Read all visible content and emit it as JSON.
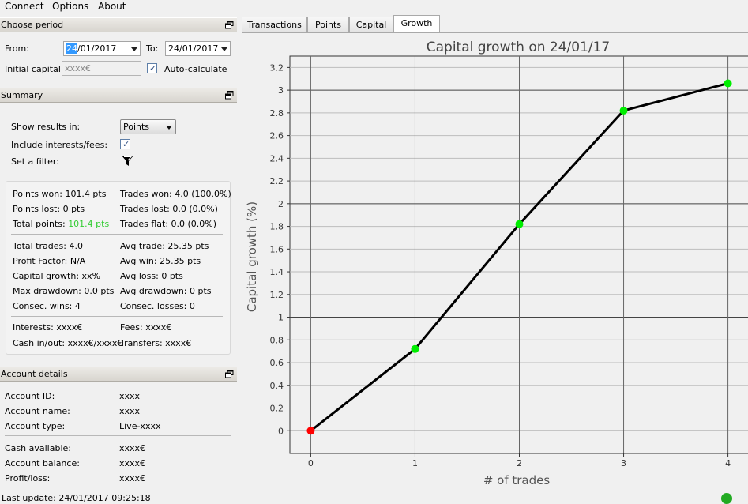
{
  "menu": {
    "items": [
      "Connect",
      "Options",
      "About"
    ]
  },
  "choose_period": {
    "title": "Choose period",
    "from_label": "From:",
    "from_value_selected": "24",
    "from_value_rest": "/01/2017",
    "to_label": "To:",
    "to_value": "24/01/2017",
    "initial_capital_label": "Initial capital:",
    "initial_capital_placeholder": "xxxx€",
    "auto_calc_label": "Auto-calculate",
    "auto_calc_checked": true
  },
  "summary": {
    "title": "Summary",
    "show_results_label": "Show results in:",
    "show_results_value": "Points",
    "include_fees_label": "Include interests/fees:",
    "include_fees_checked": true,
    "filter_label": "Set a filter:",
    "stats": {
      "points_won": "Points won: 101.4 pts",
      "trades_won": "Trades won: 4.0 (100.0%)",
      "points_lost": "Points lost: 0 pts",
      "trades_lost": "Trades lost: 0.0 (0.0%)",
      "total_points_label": "Total points: ",
      "total_points_value": "101.4 pts",
      "trades_flat": "Trades flat: 0.0 (0.0%)",
      "total_trades": "Total trades: 4.0",
      "avg_trade": "Avg trade: 25.35 pts",
      "profit_factor": "Profit Factor: N/A",
      "avg_win": "Avg win: 25.35 pts",
      "capital_growth": "Capital growth: xx%",
      "avg_loss": "Avg loss: 0 pts",
      "max_drawdown": "Max drawdown: 0.0 pts",
      "avg_drawdown": "Avg drawdown: 0 pts",
      "consec_wins": "Consec. wins: 4",
      "consec_losses": "Consec. losses: 0",
      "interests": "Interests: xxxx€",
      "fees": "Fees: xxxx€",
      "cash_inout": "Cash in/out: xxxx€/xxxx€",
      "transfers": "Transfers: xxxx€"
    }
  },
  "account": {
    "title": "Account details",
    "rows": [
      {
        "label": "Account ID:",
        "value": "xxxx"
      },
      {
        "label": "Account name:",
        "value": "xxxx"
      },
      {
        "label": "Account type:",
        "value": "Live-xxxx"
      },
      {
        "label": "Cash available:",
        "value": "xxxx€"
      },
      {
        "label": "Account balance:",
        "value": "xxxx€"
      },
      {
        "label": "Profit/loss:",
        "value": "xxxx€"
      }
    ]
  },
  "status": {
    "last_update": "Last update: 24/01/2017 09:25:18",
    "connection_color": "#22aa22"
  },
  "tabs": [
    "Transactions",
    "Points",
    "Capital",
    "Growth"
  ],
  "active_tab": "Growth",
  "colors": {
    "positive": "#33cc33",
    "point_start": "#ff0000",
    "point": "#00ee00",
    "line": "#000000"
  },
  "chart_data": {
    "type": "line",
    "title": "Capital growth on 24/01/17",
    "xlabel": "# of trades",
    "ylabel": "Capital growth (%)",
    "x": [
      0,
      1,
      2,
      3,
      4
    ],
    "y": [
      0,
      0.72,
      1.82,
      2.82,
      3.06
    ],
    "xlim": [
      -0.2,
      4.2
    ],
    "ylim": [
      -0.2,
      3.3
    ],
    "xticks": [
      "0",
      "1",
      "2",
      "3",
      "4"
    ],
    "yticks": [
      "0",
      "0.2",
      "0.4",
      "0.6",
      "0.8",
      "1",
      "1.2",
      "1.4",
      "1.6",
      "1.8",
      "2",
      "2.2",
      "2.4",
      "2.6",
      "2.8",
      "3",
      "3.2"
    ],
    "grid": true,
    "legend": "none"
  }
}
